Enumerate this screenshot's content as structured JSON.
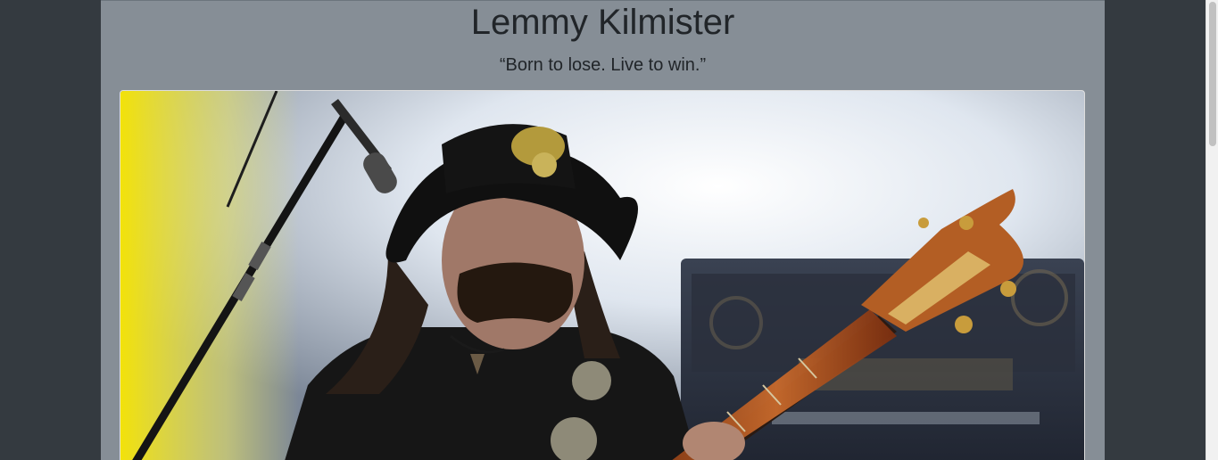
{
  "page": {
    "title": "Lemmy Kilmister",
    "quote": "“Born to lose. Live to win.”"
  },
  "photo": {
    "subject": "Lemmy Kilmister performing with bass guitar and microphone on stage"
  },
  "colors": {
    "background": "#343a40",
    "container": "#868e96",
    "text": "#212529"
  }
}
